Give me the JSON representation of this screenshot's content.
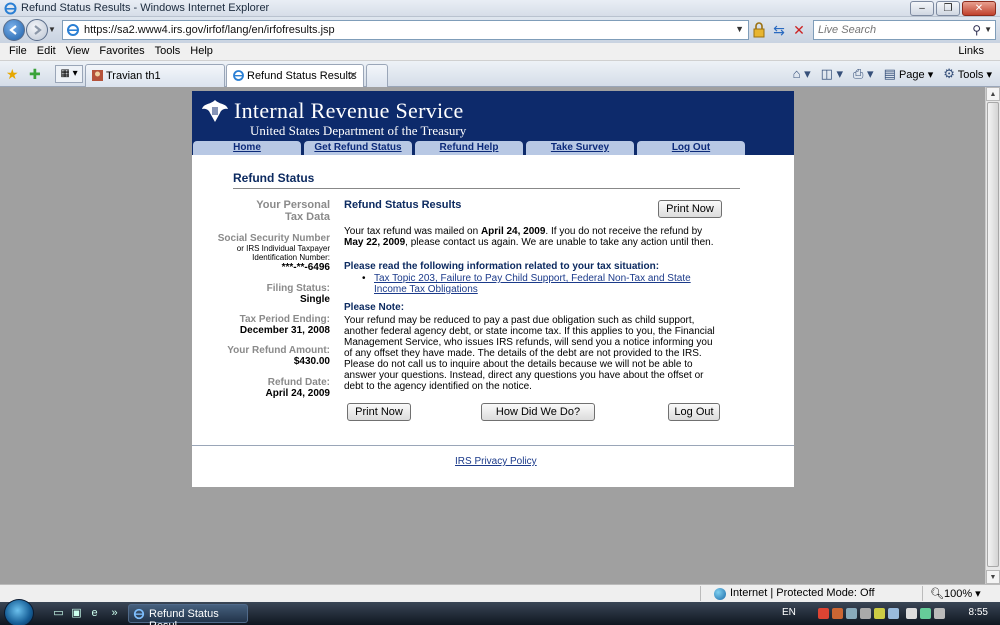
{
  "window": {
    "title": "Refund Status Results - Windows Internet Explorer"
  },
  "addressbar": {
    "url": "https://sa2.www4.irs.gov/irfof/lang/en/irfofresults.jsp",
    "search_placeholder": "Live Search"
  },
  "menubar": {
    "items": [
      "File",
      "Edit",
      "View",
      "Favorites",
      "Tools",
      "Help"
    ],
    "links_label": "Links"
  },
  "tabs": [
    {
      "label": "Travian th1"
    },
    {
      "label": "Refund Status Results"
    }
  ],
  "commandbar": {
    "page_label": "Page",
    "tools_label": "Tools"
  },
  "site": {
    "title": "Internal Revenue Service",
    "subtitle": "United States Department of the Treasury",
    "nav": [
      "Home",
      "Get Refund Status",
      "Refund Help",
      "Take Survey",
      "Log Out"
    ]
  },
  "content": {
    "section_title": "Refund Status",
    "left": {
      "personal_heading_1": "Your Personal",
      "personal_heading_2": "Tax Data",
      "ssn_label": "Social Security Number",
      "ssn_sub_1": "or IRS Individual Taxpayer",
      "ssn_sub_2": "Identification Number:",
      "ssn_value": "***-**-6496",
      "filing_label": "Filing Status:",
      "filing_value": "Single",
      "period_label": "Tax Period Ending:",
      "period_value": "December 31, 2008",
      "amount_label": "Your Refund Amount:",
      "amount_value": "$430.00",
      "date_label": "Refund Date:",
      "date_value": "April 24, 2009"
    },
    "right": {
      "results_title": "Refund Status Results",
      "print_now": "Print Now",
      "msg_part1": "Your tax refund was mailed on ",
      "msg_date1": "April 24, 2009",
      "msg_part2": ". If you do not receive the refund by ",
      "msg_date2": "May 22, 2009",
      "msg_part3": ", please contact us again. We are unable to take any action until then.",
      "info_heading": "Please read the following information related to your tax situation:",
      "info_link": "Tax Topic 203, Failure to Pay Child Support, Federal Non-Tax and State Income Tax Obligations",
      "note_heading": "Please Note:",
      "note_text": "Your refund may be reduced to pay a past due obligation such as child support, another federal agency debt, or state income tax. If this applies to you, the Financial Management Service, who issues IRS refunds, will send you a notice informing you of any offset they have made. The details of the debt are not provided to the IRS. Please do not call us to inquire about the details because we will not be able to answer your questions. Instead, direct any questions you have about the offset or debt to the agency identified on the notice."
    },
    "buttons": {
      "print_now": "Print Now",
      "how_did_we_do": "How Did We Do?",
      "log_out": "Log Out"
    },
    "privacy_link": "IRS Privacy Policy"
  },
  "statusbar": {
    "zone": "Internet | Protected Mode: Off",
    "zoom": "100%"
  },
  "taskbar": {
    "item_label": "Refund Status Resul...",
    "lang": "EN",
    "clock": "8:55"
  }
}
